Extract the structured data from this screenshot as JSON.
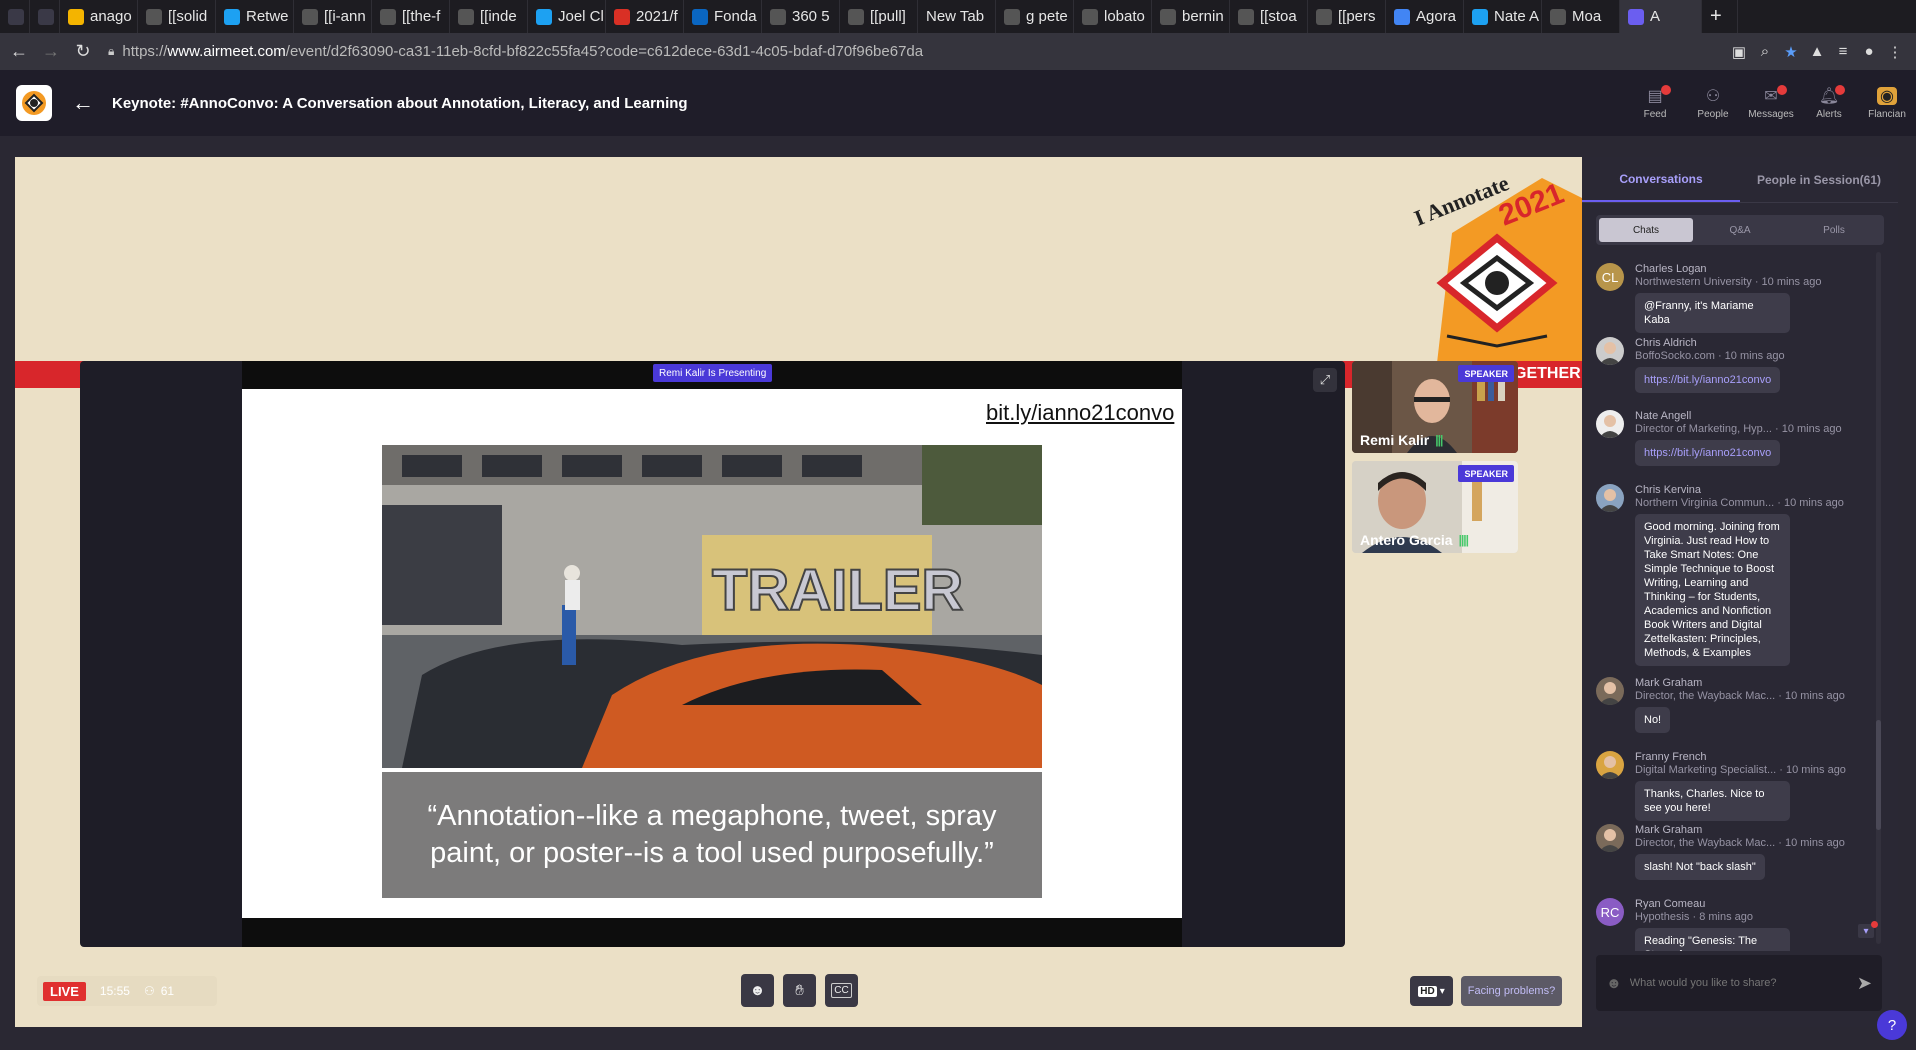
{
  "browser": {
    "tabs": [
      {
        "label": "",
        "icon": "browser-icon",
        "color": "#3a3947"
      },
      {
        "label": "",
        "icon": "mute-icon",
        "color": "#3a3947"
      },
      {
        "label": "anago",
        "icon": "keep-icon",
        "color": "#f4b400"
      },
      {
        "label": "[[solid",
        "icon": "page-icon",
        "color": "#555"
      },
      {
        "label": "Retwe",
        "icon": "twitter-icon",
        "color": "#1da1f2"
      },
      {
        "label": "[[i-ann",
        "icon": "page-icon",
        "color": "#555"
      },
      {
        "label": "[[the-f",
        "icon": "page-icon",
        "color": "#555"
      },
      {
        "label": "[[inde",
        "icon": "page-icon",
        "color": "#555"
      },
      {
        "label": "Joel Cl",
        "icon": "twitter-icon",
        "color": "#1da1f2"
      },
      {
        "label": "2021/f",
        "icon": "page-icon",
        "color": "#d93025"
      },
      {
        "label": "Fonda",
        "icon": "linkedin-icon",
        "color": "#0a66c2"
      },
      {
        "label": "360 5",
        "icon": "google-icon",
        "color": "#555"
      },
      {
        "label": "[[pull]",
        "icon": "page-icon",
        "color": "#555"
      },
      {
        "label": "New Tab",
        "icon": "",
        "color": "#555"
      },
      {
        "label": "g pete",
        "icon": "google-icon",
        "color": "#555"
      },
      {
        "label": "lobato",
        "icon": "google-icon",
        "color": "#555"
      },
      {
        "label": "bernin",
        "icon": "google-icon",
        "color": "#555"
      },
      {
        "label": "[[stoa",
        "icon": "page-icon",
        "color": "#555"
      },
      {
        "label": "[[pers",
        "icon": "page-icon",
        "color": "#555"
      },
      {
        "label": "Agora",
        "icon": "docs-icon",
        "color": "#4285f4"
      },
      {
        "label": "Nate A",
        "icon": "twitter-icon",
        "color": "#1da1f2"
      },
      {
        "label": "Moa",
        "icon": "page-icon",
        "color": "#555"
      },
      {
        "label": "A",
        "icon": "airmeet-icon",
        "color": "#6b5ef0"
      }
    ],
    "new_tab": "+",
    "url_scheme": "https://",
    "url_host": "www.airmeet.com",
    "url_path": "/event/d2f63090-ca31-11eb-8cfd-bf822c55fa45?code=c612dece-63d1-4c05-bdaf-d70f96be67da"
  },
  "header": {
    "title": "Keynote: #AnnoConvo: A Conversation about Annotation, Literacy, and Learning",
    "nav": [
      {
        "label": "Feed",
        "icon": "feed-icon",
        "dot": true
      },
      {
        "label": "People",
        "icon": "people-icon",
        "dot": false
      },
      {
        "label": "Messages",
        "icon": "messages-icon",
        "dot": true
      },
      {
        "label": "Alerts",
        "icon": "bell-icon",
        "dot": true
      },
      {
        "label": "Flancian",
        "icon": "avatar-icon",
        "dot": false
      }
    ]
  },
  "banner": {
    "logo_text": "I Annotate",
    "logo_year": "2021",
    "band_text": "GETHER"
  },
  "stage": {
    "presenting": "Remi Kalir Is Presenting",
    "slide": {
      "url": "bit.ly/ianno21convo",
      "photo_text": "TRAILER",
      "quote": "“Annotation--like a megaphone, tweet, spray paint, or poster--is a tool used purposefully.”"
    },
    "speakers": [
      {
        "name": "Remi Kalir",
        "badge": "SPEAKER"
      },
      {
        "name": "Antero Garcia",
        "badge": "SPEAKER"
      }
    ],
    "live": "LIVE",
    "timer": "15:55",
    "attendees": "61",
    "hd": "HD",
    "facing": "Facing problems?"
  },
  "panel": {
    "tabs": [
      "Conversations",
      "People in Session(61)"
    ],
    "subtabs": [
      "Chats",
      "Q&A",
      "Polls"
    ],
    "messages": [
      {
        "initials": "CL",
        "avatar_color": "#b8954a",
        "name": "Charles Logan",
        "sub": "Northwestern University · 10 mins ago",
        "text": "@Franny, it's Mariame Kaba",
        "link": false
      },
      {
        "initials": "",
        "avatar_color": "#ccc",
        "name": "Chris Aldrich",
        "sub": "BoffoSocko.com · 10 mins ago",
        "text": "https://bit.ly/ianno21convo",
        "link": true
      },
      {
        "initials": "",
        "avatar_color": "#eee",
        "name": "Nate Angell",
        "sub": "Director of Marketing, Hyp...  · 10 mins ago",
        "text": "https://bit.ly/ianno21convo",
        "link": true
      },
      {
        "initials": "",
        "avatar_color": "#8aa3c0",
        "name": "Chris Kervina",
        "sub": "Northern Virginia Commun...  · 10 mins ago",
        "text": "Good morning. Joining from Virginia. Just read How to Take Smart Notes: One Simple Technique to Boost Writing, Learning and Thinking – for Students, Academics and Nonfiction Book Writers and Digital Zettelkasten: Principles, Methods, & Examples",
        "link": false
      },
      {
        "initials": "",
        "avatar_color": "#7a6a5a",
        "name": "Mark Graham",
        "sub": "Director, the Wayback Mac...  · 10 mins ago",
        "text": "No!",
        "link": false
      },
      {
        "initials": "",
        "avatar_color": "#d9a441",
        "name": "Franny French",
        "sub": "Digital Marketing Specialist...  · 10 mins ago",
        "text": "Thanks, Charles. Nice to see you here!",
        "link": false
      },
      {
        "initials": "",
        "avatar_color": "#7a6a5a",
        "name": "Mark Graham",
        "sub": "Director, the Wayback Mac...  · 10 mins ago",
        "text": "slash! Not \"back slash\"",
        "link": false
      },
      {
        "initials": "RC",
        "avatar_color": "#8a5cc4",
        "name": "Ryan Comeau",
        "sub": "Hypothesis · 8 mins ago",
        "text": "Reading \"Genesis: The Story of",
        "link": false
      }
    ],
    "input_placeholder": "What would you like to share?",
    "help": "?"
  }
}
